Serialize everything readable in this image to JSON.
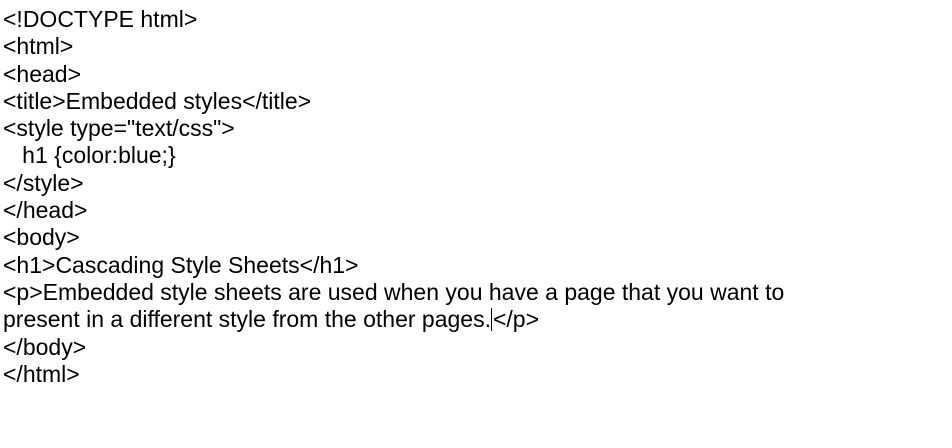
{
  "document": {
    "lines": [
      "<!DOCTYPE html>",
      "<html>",
      "<head>",
      "<title>Embedded styles</title>",
      "<style type=\"text/css\">",
      "   h1 {color:blue;}",
      "</style>",
      "</head>",
      "<body>",
      "<h1>Cascading Style Sheets</h1>",
      "<p>Embedded style sheets are used when you have a page that you want to",
      "present in a different style from the other pages.",
      "</body>",
      "</html>"
    ],
    "caret_line_tail": "</p>"
  }
}
